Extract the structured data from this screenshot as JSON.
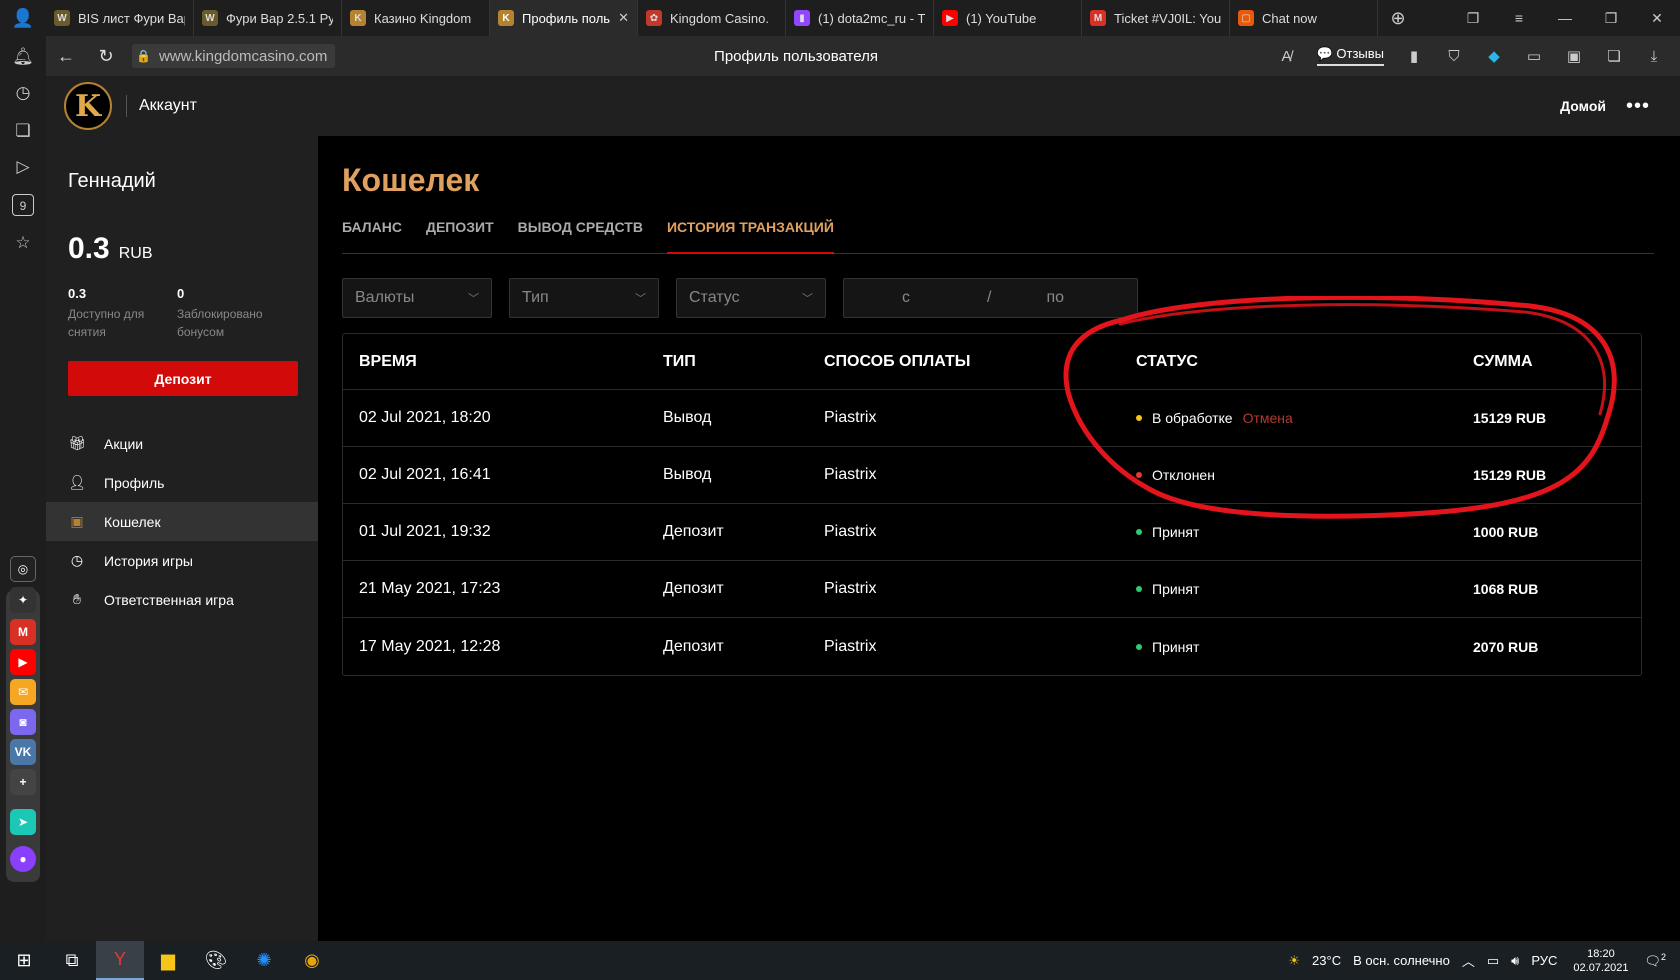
{
  "browser": {
    "tabs": [
      {
        "title": "BIS лист Фури Вар",
        "favicon": "wow-icon",
        "color": "#6b5a2a",
        "glyph": "W",
        "active": false
      },
      {
        "title": "Фури Вар 2.5.1 Ру",
        "favicon": "wow-icon",
        "color": "#6b5a2a",
        "glyph": "W",
        "active": false
      },
      {
        "title": "Казино Kingdom",
        "favicon": "kingdom-crown-icon",
        "color": "#b5832f",
        "glyph": "K",
        "active": false
      },
      {
        "title": "Профиль поль",
        "favicon": "kingdom-k-icon",
        "color": "#b5832f",
        "glyph": "K",
        "active": true
      },
      {
        "title": "Kingdom Casino.",
        "favicon": "poker-chip-icon",
        "color": "#c0392b",
        "glyph": "✿",
        "active": false
      },
      {
        "title": "(1) dota2mc_ru - T",
        "favicon": "twitch-icon",
        "color": "#9146ff",
        "glyph": "▮",
        "active": false
      },
      {
        "title": "(1) YouTube",
        "favicon": "youtube-icon",
        "color": "#ff0000",
        "glyph": "▶",
        "active": false
      },
      {
        "title": "Ticket #VJ0IL: You",
        "favicon": "gmail-icon",
        "color": "#d93025",
        "glyph": "M",
        "active": false
      },
      {
        "title": "Chat now",
        "favicon": "chat-icon",
        "color": "#e8590c",
        "glyph": "▢",
        "active": false
      }
    ],
    "url": "www.kingdomcasino.com",
    "page_title": "Профиль пользователя",
    "reviews_label": "Отзывы"
  },
  "site": {
    "logo_letter": "K",
    "header_title": "Аккаунт",
    "home_link": "Домой",
    "more_label": "•••"
  },
  "account": {
    "user_name": "Геннадий",
    "balance_amount": "0.3",
    "balance_currency": "RUB",
    "available_value": "0.3",
    "available_label": "Доступно для снятия",
    "blocked_value": "0",
    "blocked_label": "Заблокировано бонусом",
    "deposit_label": "Депозит",
    "menu": [
      {
        "label": "Акции",
        "icon": "gift-icon",
        "active": false
      },
      {
        "label": "Профиль",
        "icon": "user-icon",
        "active": false
      },
      {
        "label": "Кошелек",
        "icon": "wallet-icon",
        "active": true
      },
      {
        "label": "История игры",
        "icon": "clock-icon",
        "active": false
      },
      {
        "label": "Ответственная игра",
        "icon": "hand-icon",
        "active": false
      }
    ]
  },
  "wallet": {
    "title": "Кошелек",
    "tabs": [
      {
        "label": "БАЛАНС",
        "active": false
      },
      {
        "label": "ДЕПОЗИТ",
        "active": false
      },
      {
        "label": "ВЫВОД СРЕДСТВ",
        "active": false
      },
      {
        "label": "ИСТОРИЯ ТРАНЗАКЦИЙ",
        "active": true
      }
    ],
    "filters": {
      "currency_placeholder": "Валюты",
      "type_placeholder": "Тип",
      "status_placeholder": "Статус",
      "date_from": "с",
      "date_sep": "/",
      "date_to": "по"
    },
    "columns": {
      "time": "ВРЕМЯ",
      "type": "ТИП",
      "payment": "СПОСОБ ОПЛАТЫ",
      "status": "СТАТУС",
      "amount": "СУММА"
    },
    "transactions": [
      {
        "time": "02 Jul 2021, 18:20",
        "type": "Вывод",
        "payment": "Piastrix",
        "status": "В обработке",
        "status_color": "#f5c518",
        "action": "Отмена",
        "amount": "15129 RUB"
      },
      {
        "time": "02 Jul 2021, 16:41",
        "type": "Вывод",
        "payment": "Piastrix",
        "status": "Отклонен",
        "status_color": "#e53935",
        "action": "",
        "amount": "15129 RUB"
      },
      {
        "time": "01 Jul 2021, 19:32",
        "type": "Депозит",
        "payment": "Piastrix",
        "status": "Принят",
        "status_color": "#2ecc71",
        "action": "",
        "amount": "1000 RUB"
      },
      {
        "time": "21 May 2021, 17:23",
        "type": "Депозит",
        "payment": "Piastrix",
        "status": "Принят",
        "status_color": "#2ecc71",
        "action": "",
        "amount": "1068 RUB"
      },
      {
        "time": "17 May 2021, 12:28",
        "type": "Депозит",
        "payment": "Piastrix",
        "status": "Принят",
        "status_color": "#2ecc71",
        "action": "",
        "amount": "2070 RUB"
      }
    ]
  },
  "taskbar": {
    "weather_temp": "23°C",
    "weather_text": "В осн. солнечно",
    "language": "РУС",
    "time": "18:20",
    "date": "02.07.2021",
    "notification_count": "2"
  },
  "colors": {
    "accent_gold": "#e0a160",
    "brand_red": "#d20a0a",
    "annotation_red": "#e3141b"
  }
}
